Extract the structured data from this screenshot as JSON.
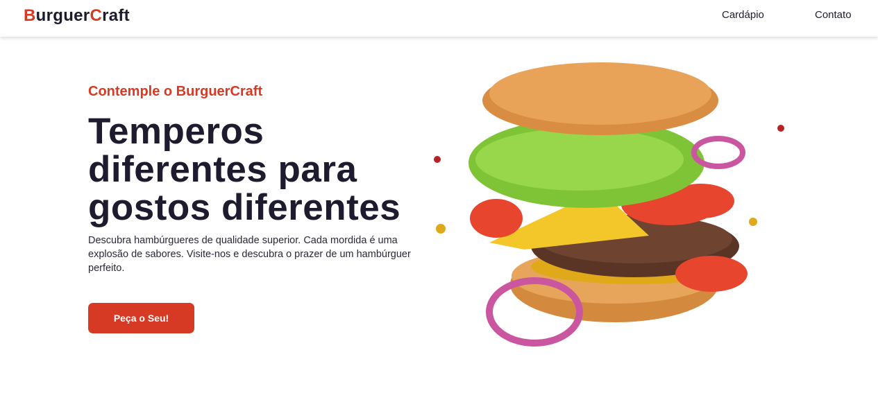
{
  "header": {
    "logo": {
      "first_letter": "B",
      "part1": "urguer",
      "second_letter": "C",
      "part2": "raft"
    },
    "nav": [
      "Cardápio",
      "Contato"
    ]
  },
  "hero": {
    "subtitle": "Contemple o BurguerCraft",
    "title_lines": [
      "Temperos",
      "diferentes para",
      "gostos diferentes"
    ],
    "description": "Descubra hambúrgueres de qualidade superior. Cada mordida é uma explosão de sabores. Visite-nos e descubra o prazer de um hambúrguer perfeito.",
    "cta": "Peça o Seu!"
  },
  "colors": {
    "accent": "#d63a25",
    "text": "#1e1b2e"
  }
}
